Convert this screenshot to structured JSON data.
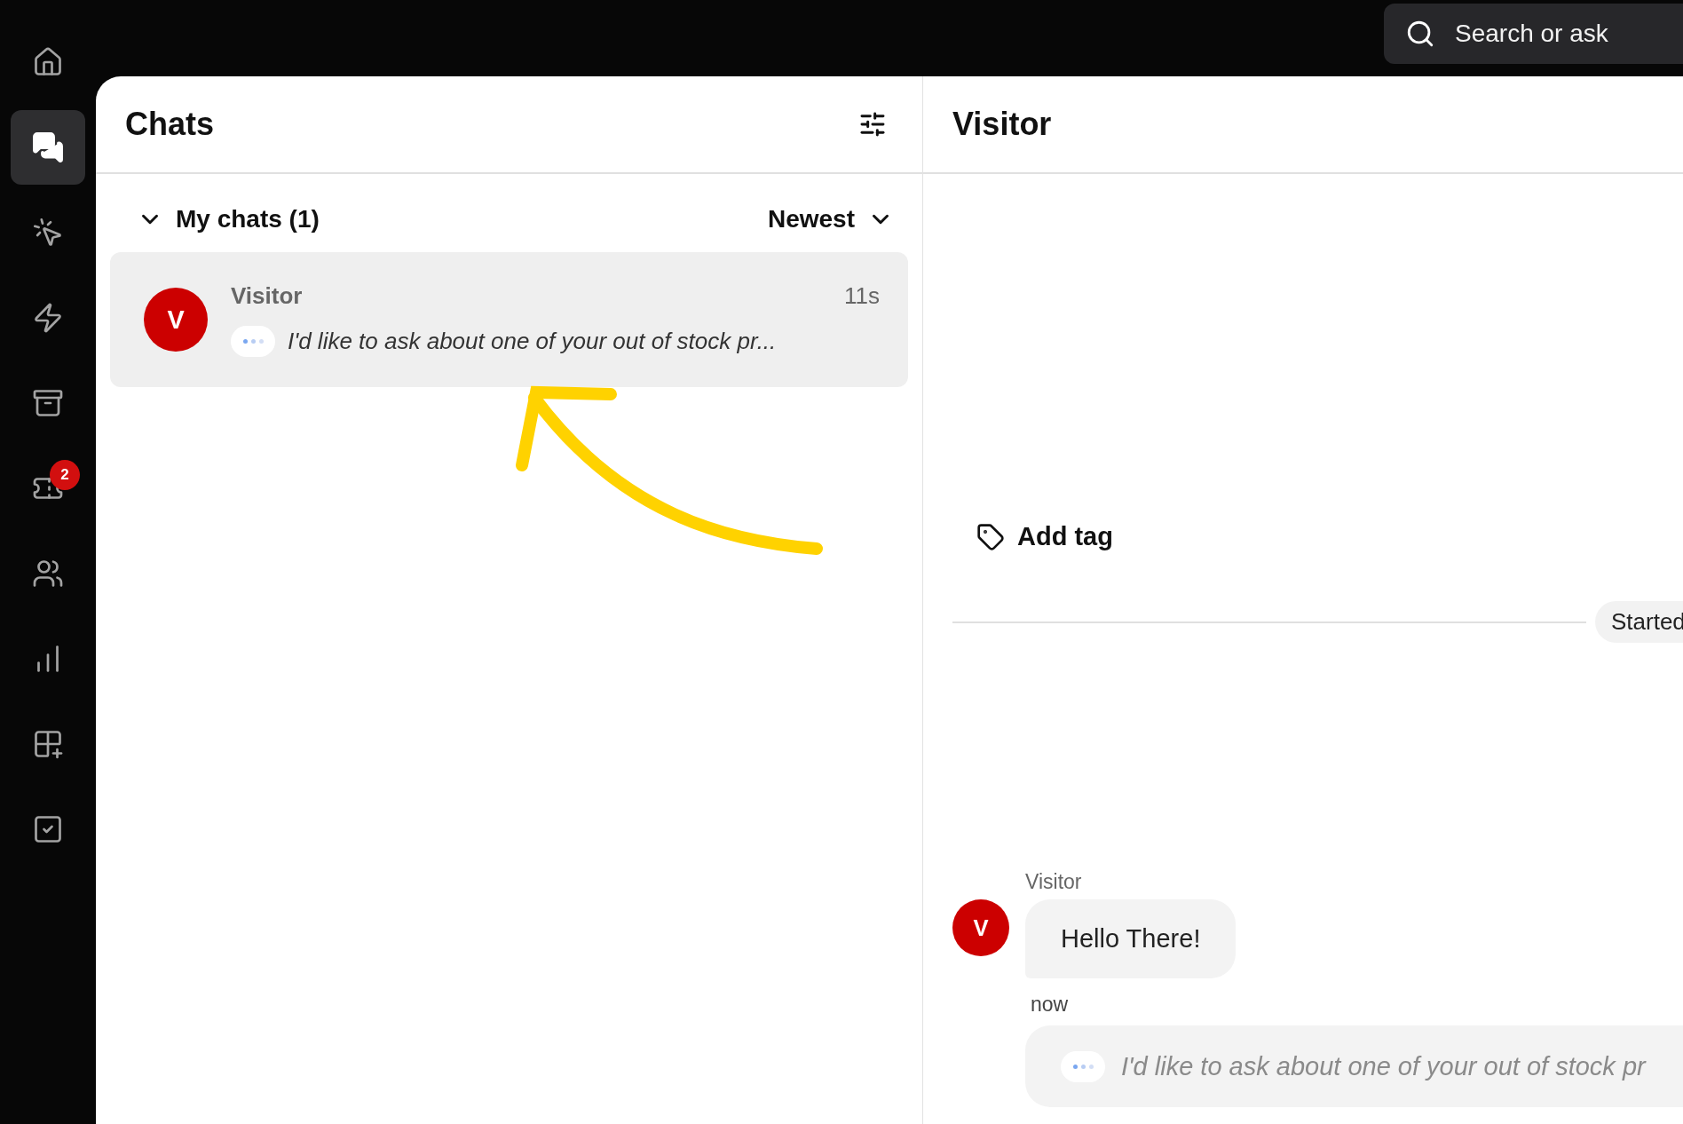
{
  "sidebar": {
    "items": [
      {
        "kind": "home",
        "selected": false
      },
      {
        "kind": "chats",
        "selected": true
      },
      {
        "kind": "engage",
        "selected": false
      },
      {
        "kind": "automations",
        "selected": false
      },
      {
        "kind": "archive",
        "selected": false
      },
      {
        "kind": "tickets",
        "selected": false,
        "badge": "2"
      },
      {
        "kind": "customers",
        "selected": false
      },
      {
        "kind": "reports",
        "selected": false
      },
      {
        "kind": "apps",
        "selected": false
      },
      {
        "kind": "tasks",
        "selected": false
      }
    ]
  },
  "search": {
    "placeholder": "Search or ask"
  },
  "chat_list": {
    "title": "Chats",
    "group": {
      "label": "My chats (1)",
      "expanded": true
    },
    "sort": "Newest",
    "chats": [
      {
        "name": "Visitor",
        "avatar": "V",
        "time": "11s",
        "preview": "I'd like to ask about one of your out of stock pr...",
        "selected": true
      }
    ]
  },
  "conversation": {
    "title": "Visitor",
    "add_tag": "Add tag",
    "divider_label": "Started",
    "messages": [
      {
        "kind": "text",
        "author": "Visitor",
        "avatar": "V",
        "text": "Hello There!",
        "time": "now"
      },
      {
        "kind": "typing",
        "text": "I'd like to ask about one of your out of stock pr"
      }
    ]
  }
}
